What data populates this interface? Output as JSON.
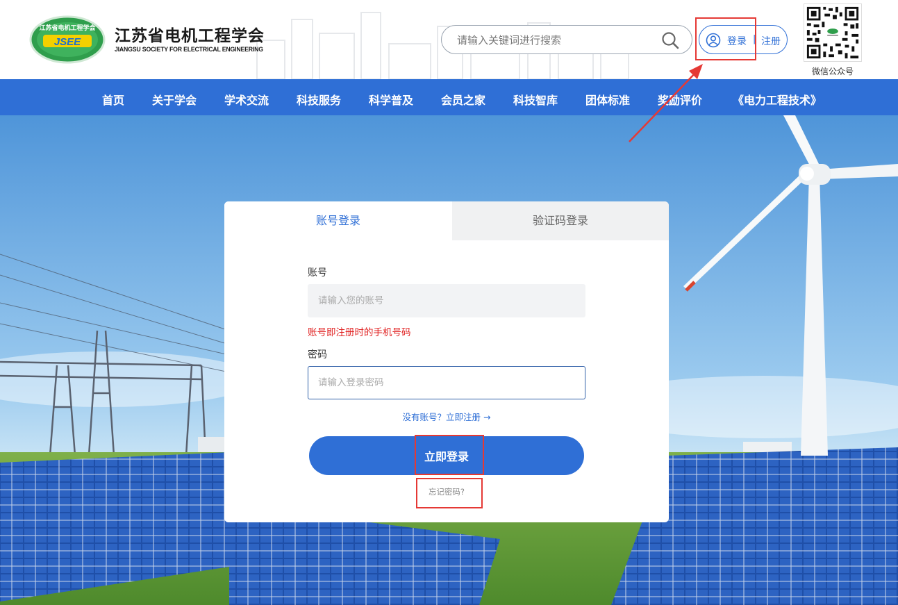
{
  "header": {
    "logo_text": "江苏省电机工程学会",
    "logo_abbr": "JSEE",
    "site_title": "江苏省电机工程学会",
    "site_subtitle": "JIANGSU SOCIETY FOR ELECTRICAL ENGINEERING",
    "search_placeholder": "请输入关键词进行搜索",
    "login_label": "登录",
    "separator": "|",
    "register_label": "注册",
    "qr_label": "微信公众号"
  },
  "nav": {
    "items": [
      "首页",
      "关于学会",
      "学术交流",
      "科技服务",
      "科学普及",
      "会员之家",
      "科技智库",
      "团体标准",
      "奖励评价",
      "《电力工程技术》"
    ]
  },
  "login": {
    "tabs": [
      {
        "label": "账号登录",
        "active": true
      },
      {
        "label": "验证码登录",
        "active": false
      }
    ],
    "account_label": "账号",
    "account_placeholder": "请输入您的账号",
    "account_hint": "账号即注册时的手机号码",
    "password_label": "密码",
    "password_placeholder": "请输入登录密码",
    "register_prompt": "没有账号？立即注册 →",
    "submit_label": "立即登录",
    "forgot_label": "忘记密码?"
  },
  "colors": {
    "primary": "#2f6fd6",
    "hint_red": "#e02020",
    "annotation": "#e53935"
  }
}
